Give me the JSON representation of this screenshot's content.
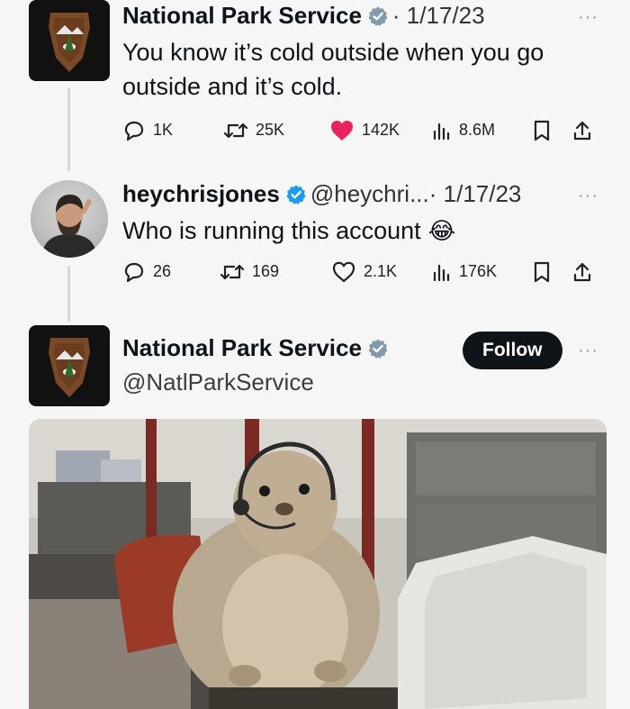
{
  "tweet1": {
    "name": "National Park Service",
    "date": "· 1/17/23",
    "text_line1": "You know it’s cold outside when you go",
    "text_line2": "outside and it’s cold.",
    "replies": "1K",
    "retweets": "25K",
    "likes": "142K",
    "views": "8.6M",
    "more": "···"
  },
  "tweet2": {
    "name": "heychrisjones",
    "handle": "@heychri...",
    "date": "· 1/17/23",
    "text": "Who is running this account",
    "emoji": "😂",
    "replies": "26",
    "retweets": "169",
    "likes": "2.1K",
    "views": "176K",
    "more": "···"
  },
  "tweet3": {
    "name": "National Park Service",
    "handle": "@NatlParkService",
    "follow_label": "Follow",
    "more": "···"
  },
  "colors": {
    "like_active": "#e8245c",
    "verified_gray": "#829aab",
    "verified_blue": "#1d9bf0",
    "text": "#0f1419",
    "background": "#f6f6f6"
  },
  "icons": [
    "reply-icon",
    "retweet-icon",
    "like-icon",
    "views-icon",
    "bookmark-icon",
    "share-icon",
    "verified-badge-icon"
  ]
}
